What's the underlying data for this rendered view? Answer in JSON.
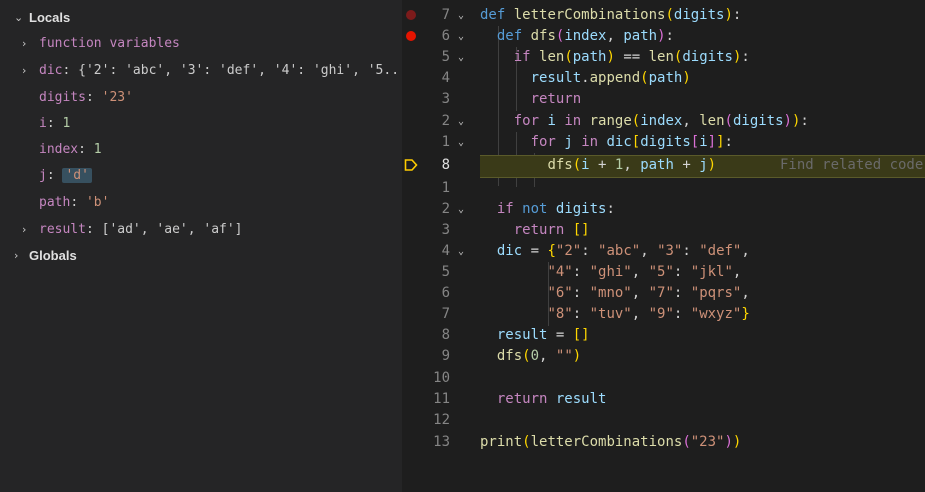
{
  "variables": {
    "locals_label": "Locals",
    "globals_label": "Globals",
    "items": [
      {
        "name": "function variables",
        "sep": "",
        "value": "",
        "vclass": ""
      },
      {
        "name": "dic",
        "sep": ": ",
        "value": "{'2': 'abc', '3': 'def', '4': 'ghi', '5...",
        "vclass": "vgray"
      },
      {
        "name": "digits",
        "sep": ": ",
        "value": "'23'",
        "vclass": "vstr"
      },
      {
        "name": "i",
        "sep": ": ",
        "value": "1",
        "vclass": "vnum"
      },
      {
        "name": "index",
        "sep": ": ",
        "value": "1",
        "vclass": "vnum"
      },
      {
        "name": "j",
        "sep": ": ",
        "value": "'d'",
        "vclass": "vstr"
      },
      {
        "name": "path",
        "sep": ": ",
        "value": "'b'",
        "vclass": "vstr"
      },
      {
        "name": "result",
        "sep": ": ",
        "value": "['ad', 'ae', 'af']",
        "vclass": "vgray"
      }
    ]
  },
  "editor": {
    "current_line_number": "8",
    "hint": "Find related code",
    "line_numbers": [
      "7",
      "6",
      "5",
      "4",
      "3",
      "2",
      "1",
      "8",
      "1",
      "2",
      "3",
      "4",
      "5",
      "6",
      "7",
      "8",
      "9",
      "10",
      "11",
      "12",
      "13"
    ]
  },
  "colors": {
    "breakpoint": "#e51400",
    "current_line_arrow": "#ffcc00"
  }
}
